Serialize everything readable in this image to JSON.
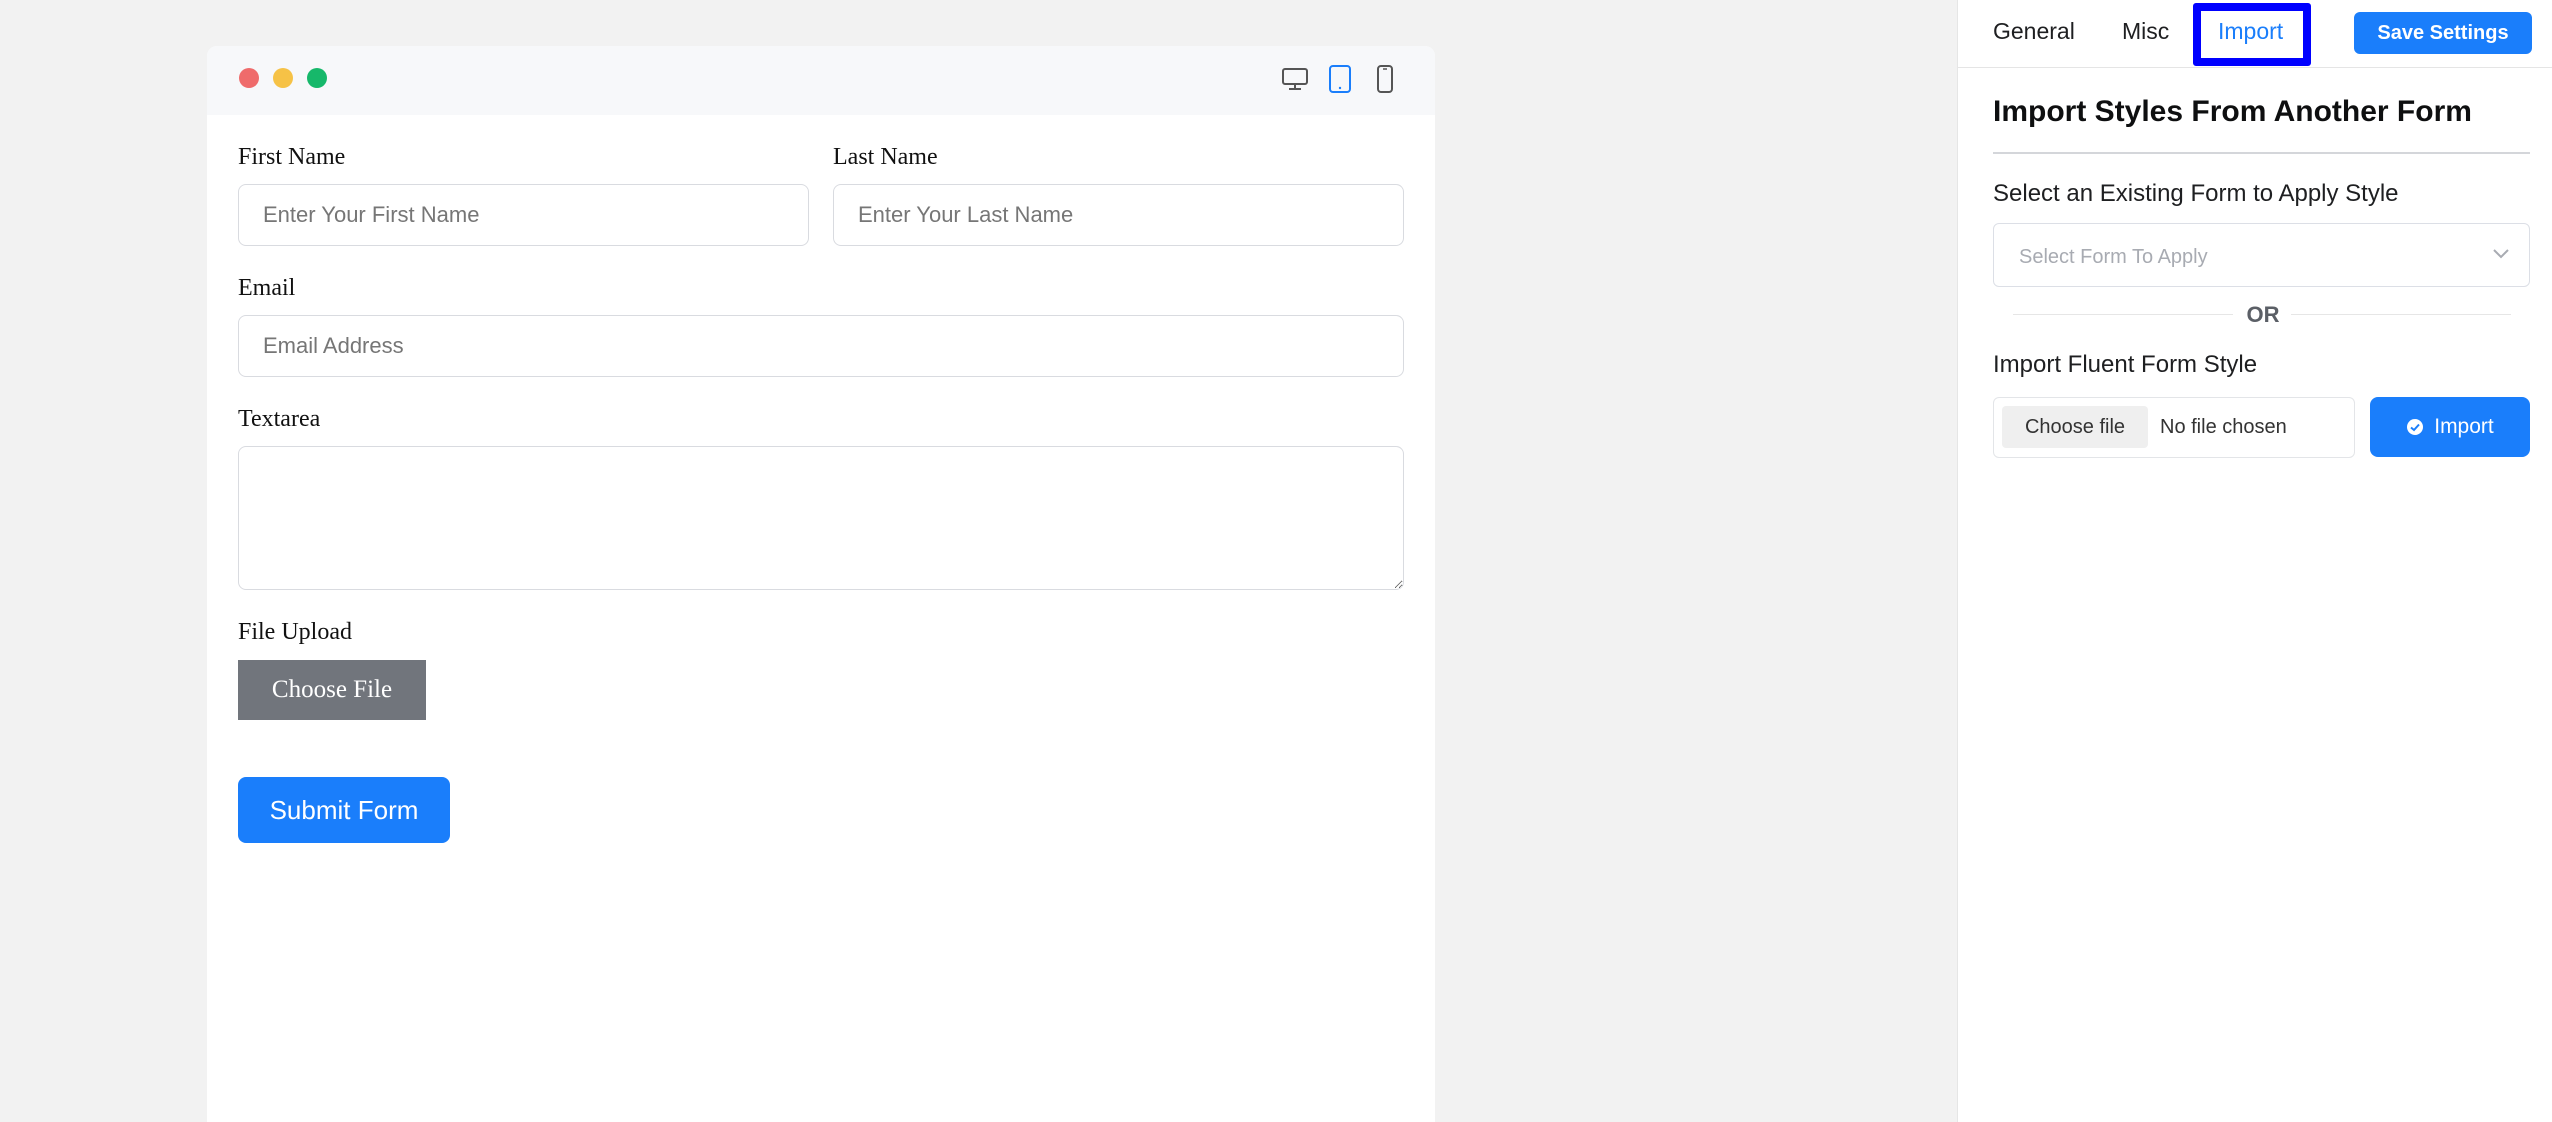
{
  "preview": {
    "devices": [
      "desktop-icon",
      "tablet-icon",
      "mobile-icon"
    ],
    "active_device": "tablet"
  },
  "form": {
    "first_name_label": "First Name",
    "first_name_placeholder": "Enter Your First Name",
    "last_name_label": "Last Name",
    "last_name_placeholder": "Enter Your Last Name",
    "email_label": "Email",
    "email_placeholder": "Email Address",
    "textarea_label": "Textarea",
    "file_upload_label": "File Upload",
    "choose_file_label": "Choose File",
    "submit_label": "Submit Form"
  },
  "sidebar": {
    "tabs": [
      {
        "label": "General"
      },
      {
        "label": "Misc"
      },
      {
        "label": "Import"
      }
    ],
    "active_tab": "Import",
    "save_label": "Save Settings",
    "title": "Import Styles From Another Form",
    "select_label": "Select an Existing Form to Apply Style",
    "select_placeholder": "Select Form To Apply",
    "or_text": "OR",
    "import_label": "Import Fluent Form Style",
    "choose_file_label": "Choose file",
    "no_file_text": "No file chosen",
    "import_button_label": "Import"
  },
  "colors": {
    "accent": "#1a7efb",
    "highlight_border": "#0000ff",
    "dot_red": "#ef6b6b",
    "dot_yellow": "#f6c246",
    "dot_green": "#16b86a",
    "file_button": "#71757c"
  }
}
